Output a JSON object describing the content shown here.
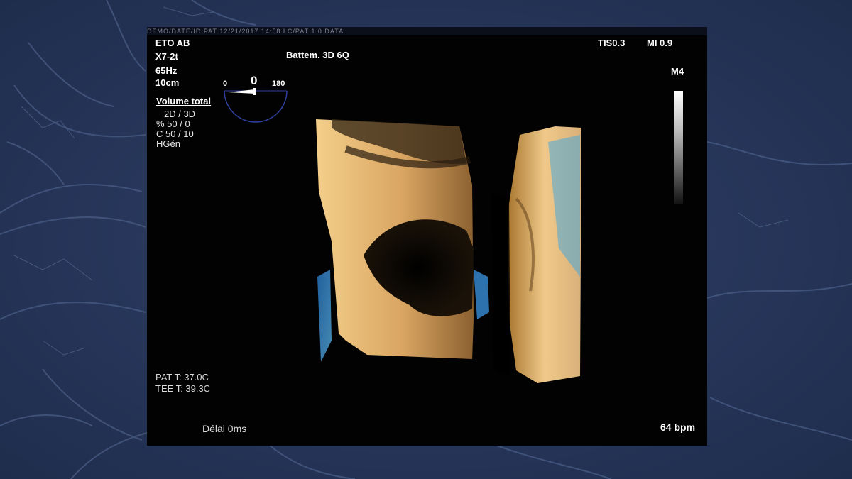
{
  "header_strip": "DEMO/DATE/ID PAT 12/21/2017 14:58 LC/PAT 1.0 DATA",
  "screen": {
    "exam": "ETO AB",
    "probe": "X7-2t",
    "frequency": "65Hz",
    "depth": "10cm",
    "mode": "Battem. 3D 6Q",
    "tis": "TIS0.3",
    "mi": "MI 0.9",
    "map": "M4",
    "angle": {
      "min": "0",
      "current": "0",
      "max": "180"
    },
    "volume": {
      "title": "Volume total",
      "line1": "2D / 3D",
      "line2": "% 50 / 0",
      "line3": "C  50 / 10",
      "line4": "HGén"
    },
    "temps": {
      "pat": "PAT T: 37.0C",
      "tee": "TEE T: 39.3C"
    },
    "delay": "Délai 0ms",
    "heart_rate": "64 bpm"
  },
  "colors": {
    "background": "#2a3a5e",
    "screen": "#020202",
    "tissue_gold": "#e0b070",
    "tissue_blue": "#3aa0e8"
  }
}
